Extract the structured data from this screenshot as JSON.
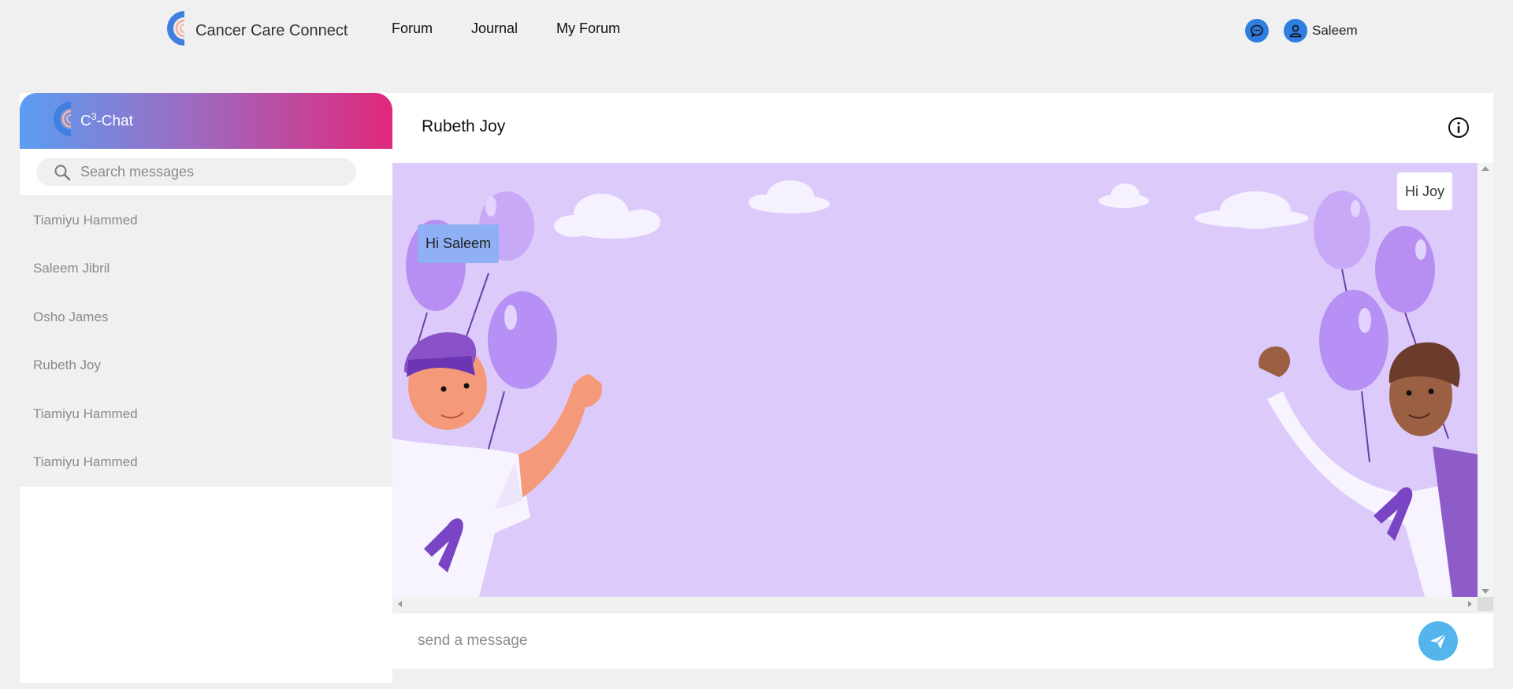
{
  "brand": {
    "name": "Cancer Care Connect"
  },
  "nav": {
    "forum": "Forum",
    "journal": "Journal",
    "my_forum": "My Forum"
  },
  "user": {
    "name": "Saleem"
  },
  "sidebar": {
    "title_prefix": "C",
    "title_sup": "3",
    "title_suffix": "-Chat",
    "search_placeholder": "Search messages",
    "contacts": [
      "Tiamiyu Hammed",
      "Saleem Jibril",
      "Osho James",
      "Rubeth Joy",
      "Tiamiyu Hammed",
      "Tiamiyu Hammed"
    ]
  },
  "chat": {
    "title": "Rubeth Joy",
    "messages": [
      {
        "text": "Hi Saleem",
        "side": "received"
      },
      {
        "text": "Hi Joy",
        "side": "sent"
      }
    ],
    "input_placeholder": "send a message"
  },
  "colors": {
    "accent": "#2f7de1",
    "chat_bg": "#dccbfa",
    "received_bubble": "#8fb0f4",
    "send_button": "#53b5eb",
    "header_gradient": [
      "#5b9df2",
      "#9b6cc2",
      "#e0287c"
    ]
  },
  "icons": {
    "chat": "chat-bubble-icon",
    "user": "user-icon",
    "search": "search-icon",
    "info": "info-icon",
    "send": "send-icon"
  }
}
